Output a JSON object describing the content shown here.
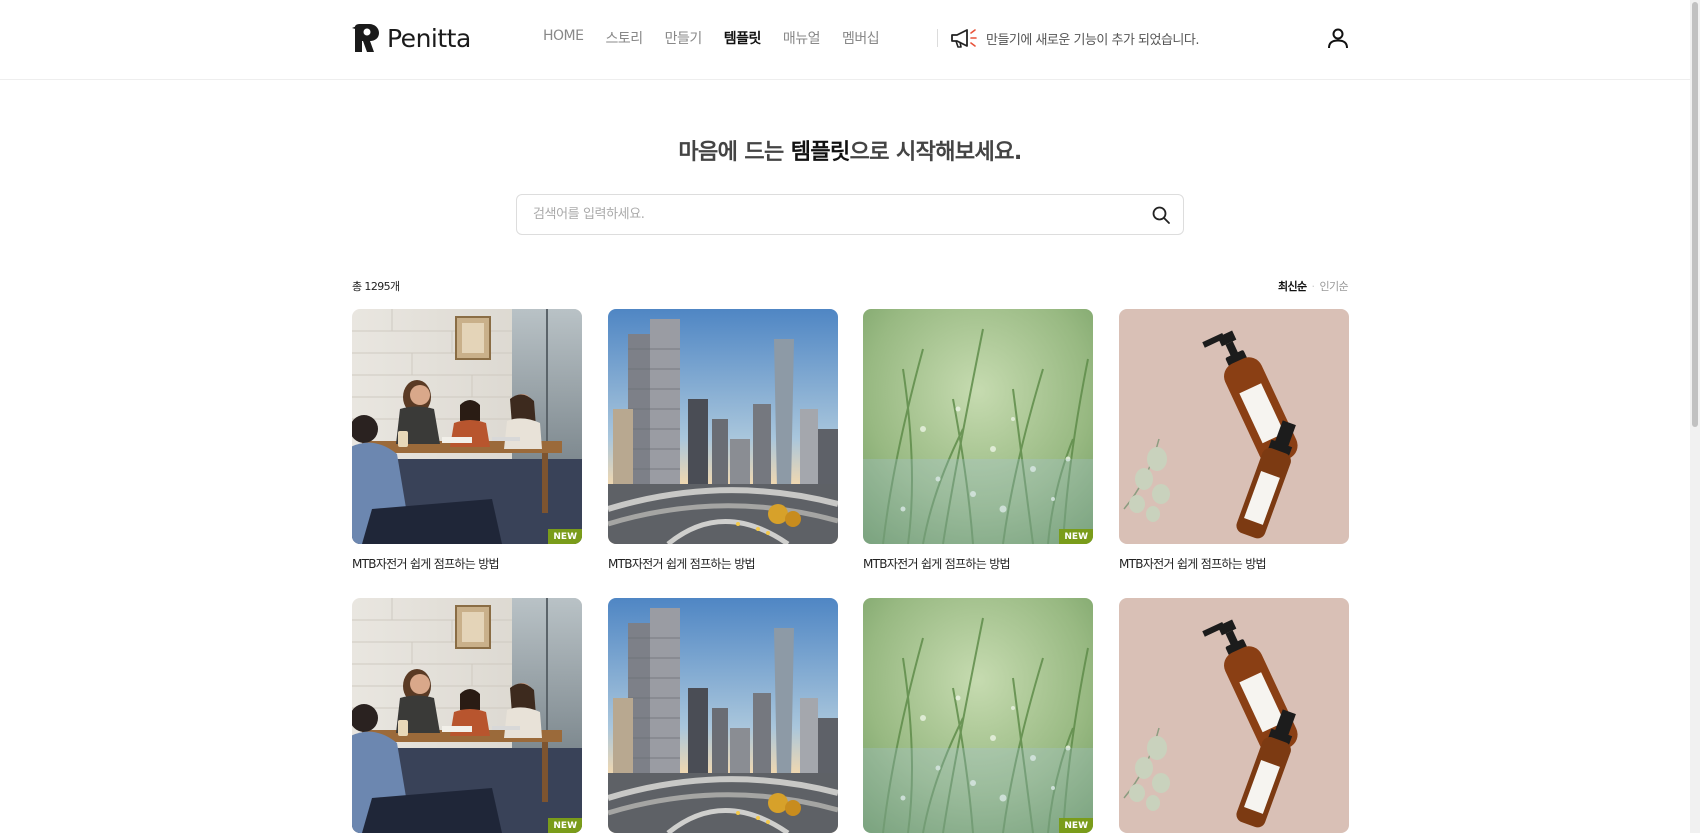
{
  "header": {
    "logo_text": "Penitta",
    "nav": [
      {
        "label": "HOME",
        "active": false
      },
      {
        "label": "스토리",
        "active": false
      },
      {
        "label": "만들기",
        "active": false
      },
      {
        "label": "템플릿",
        "active": true
      },
      {
        "label": "매뉴얼",
        "active": false
      },
      {
        "label": "멤버십",
        "active": false
      }
    ],
    "notice_text": "만들기에 새로운 기능이 추가 되었습니다.",
    "notice_icon": "megaphone-icon",
    "user_icon": "user-icon"
  },
  "hero": {
    "title_pre": "마음에 드는 ",
    "title_bold": "템플릿",
    "title_post": "으로 시작해보세요."
  },
  "search": {
    "placeholder": "검색어를 입력하세요.",
    "value": "",
    "icon": "search-icon"
  },
  "toolbar": {
    "count_text": "총 1295개",
    "sort_options": [
      {
        "label": "최신순",
        "active": true
      },
      {
        "label": "인기순",
        "active": false
      }
    ]
  },
  "templates": [
    {
      "title": "MTB자전거 쉽게 점프하는 방법",
      "image": "office-meeting",
      "badge": "NEW"
    },
    {
      "title": "MTB자전거 쉽게 점프하는 방법",
      "image": "city-skyline",
      "badge": ""
    },
    {
      "title": "MTB자전거 쉽게 점프하는 방법",
      "image": "green-grass",
      "badge": "NEW"
    },
    {
      "title": "MTB자전거 쉽게 점프하는 방법",
      "image": "cosmetic-bottles",
      "badge": ""
    },
    {
      "title": "",
      "image": "office-meeting",
      "badge": "NEW"
    },
    {
      "title": "",
      "image": "city-skyline",
      "badge": ""
    },
    {
      "title": "",
      "image": "green-grass",
      "badge": "NEW"
    },
    {
      "title": "",
      "image": "cosmetic-bottles",
      "badge": ""
    }
  ],
  "colors": {
    "badge_new": "#7a9c1a",
    "text_primary": "#111111",
    "text_muted": "#888888"
  }
}
